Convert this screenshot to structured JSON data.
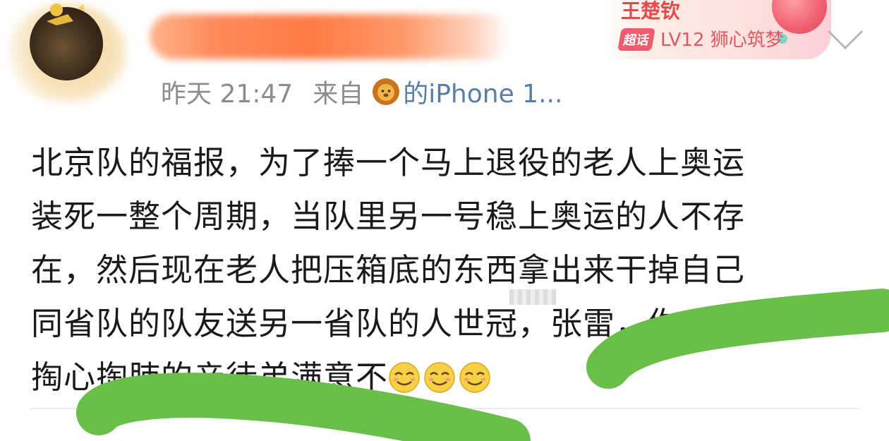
{
  "post": {
    "username": "",
    "time": "昨天 21:47",
    "from_label": "来自",
    "device": "的iPhone 1..."
  },
  "badge": {
    "name": "王楚钦",
    "tag": "超话",
    "level": "LV12 狮心筑梦"
  },
  "content": {
    "lines": [
      "北京队的福报，为了捧一个马上退役的老人上奥运",
      "装死一整个周期，当队里另一号稳上奥运的人不存",
      "在，然后现在老人把压箱底的东西拿出来干掉自己",
      "同省队的队友送另一省队的人世冠，张雷，你对你",
      "掏心掏肺的亲徒弟满意不"
    ]
  },
  "icons": {
    "avatar": "avatar",
    "lion": "lion-icon",
    "chevron": "chevron-down-icon",
    "emoji": "smirk-emoji-icon"
  },
  "colors": {
    "link": "#587ea5",
    "meta": "#8c8c8c",
    "badge_name": "#e04a4a",
    "scribble_green": "#6abf4b",
    "username_redaction": "#ff7a45"
  }
}
